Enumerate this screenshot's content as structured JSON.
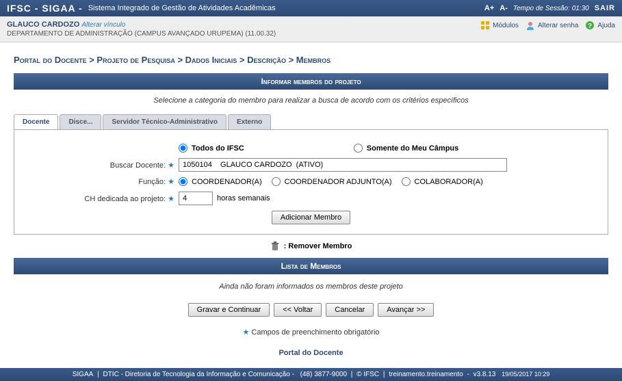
{
  "topbar": {
    "title": "IFSC - SIGAA -",
    "subtitle": "Sistema Integrado de Gestão de Atividades Acadêmicas",
    "font_inc": "A+",
    "font_dec": "A-",
    "session_label": "Tempo de Sessão:",
    "session_time": "01:30",
    "logout": "SAIR"
  },
  "userbar": {
    "username": "GLAUCO CARDOZO",
    "change_link": "Alterar vínculo",
    "dept": "DEPARTAMENTO DE ADMINISTRAÇÃO (CAMPUS AVANÇADO URUPEMA) (11.00.32)",
    "modules": "Módulos",
    "password": "Alterar senha",
    "help": "Ajuda"
  },
  "breadcrumb": "Portal do Docente > Projeto de Pesquisa > Dados Iniciais > Descrição > Membros",
  "section_title": "Informar membros do projeto",
  "instruction": "Selecione a categoria do membro para realizar a busca de acordo com os critérios específicos",
  "tabs": {
    "t1": "Docente",
    "t2": "Disce...",
    "t3": "Servidor Técnico-Administrativo",
    "t4": "Externo"
  },
  "form": {
    "scope_all": "Todos do IFSC",
    "scope_mine": "Somente do Meu Câmpus",
    "search_label": "Buscar Docente:",
    "search_value": "1050104    GLAUCO CARDOZO  (ATIVO)",
    "role_label": "Função:",
    "role_coord": "COORDENADOR(A)",
    "role_adj": "COORDENADOR ADJUNTO(A)",
    "role_colab": "COLABORADOR(A)",
    "ch_label": "CH dedicada ao projeto:",
    "ch_value": "4",
    "ch_suffix": "horas semanais",
    "add_btn": "Adicionar Membro"
  },
  "legend": {
    "remove": ": Remover Membro"
  },
  "list_title": "Lista de Membros",
  "empty": "Ainda não foram informados os membros deste projeto",
  "buttons": {
    "save": "Gravar e Continuar",
    "back": "<< Voltar",
    "cancel": "Cancelar",
    "next": "Avançar >>"
  },
  "mandatory": "Campos de preenchimento obrigatório",
  "portal_link": "Portal do Docente",
  "footer": {
    "p1": "SIGAA",
    "p2": "DTIC - Diretoria de Tecnologia da Informação e Comunicação -",
    "phone": "(48) 3877-9000",
    "org": "© IFSC",
    "env": "treinamento.treinamento",
    "ver": "v3.8.13",
    "ts": "19/05/2017 10:29"
  }
}
